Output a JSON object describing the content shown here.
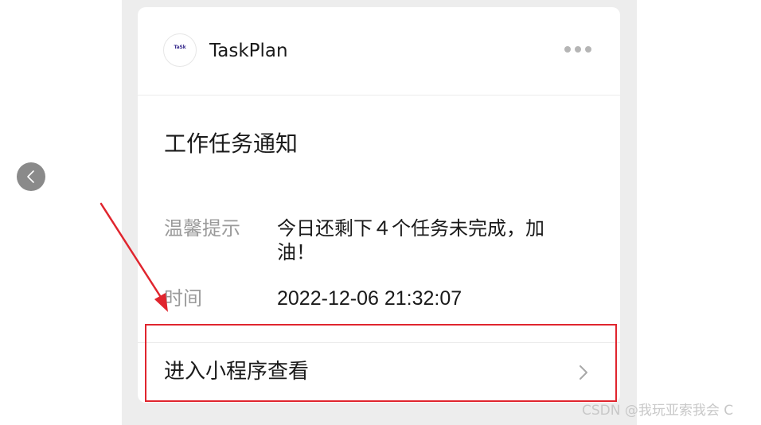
{
  "header": {
    "app_name": "TaskPlan",
    "avatar_mark": "TaSk",
    "more_icon": "more-dots-icon"
  },
  "card": {
    "title": "工作任务通知",
    "rows": [
      {
        "label": "温馨提示",
        "value": "今日还剩下４个任务未完成，加油！"
      },
      {
        "label": "时间",
        "value": "2022-12-06 21:32:07"
      }
    ]
  },
  "footer": {
    "link_label": "进入小程序查看",
    "chevron_icon": "chevron-right-icon"
  },
  "nav": {
    "back_icon": "chevron-left-icon"
  },
  "annotation": {
    "color": "#e0252e"
  },
  "watermark": "CSDN @我玩亚索我会 C"
}
